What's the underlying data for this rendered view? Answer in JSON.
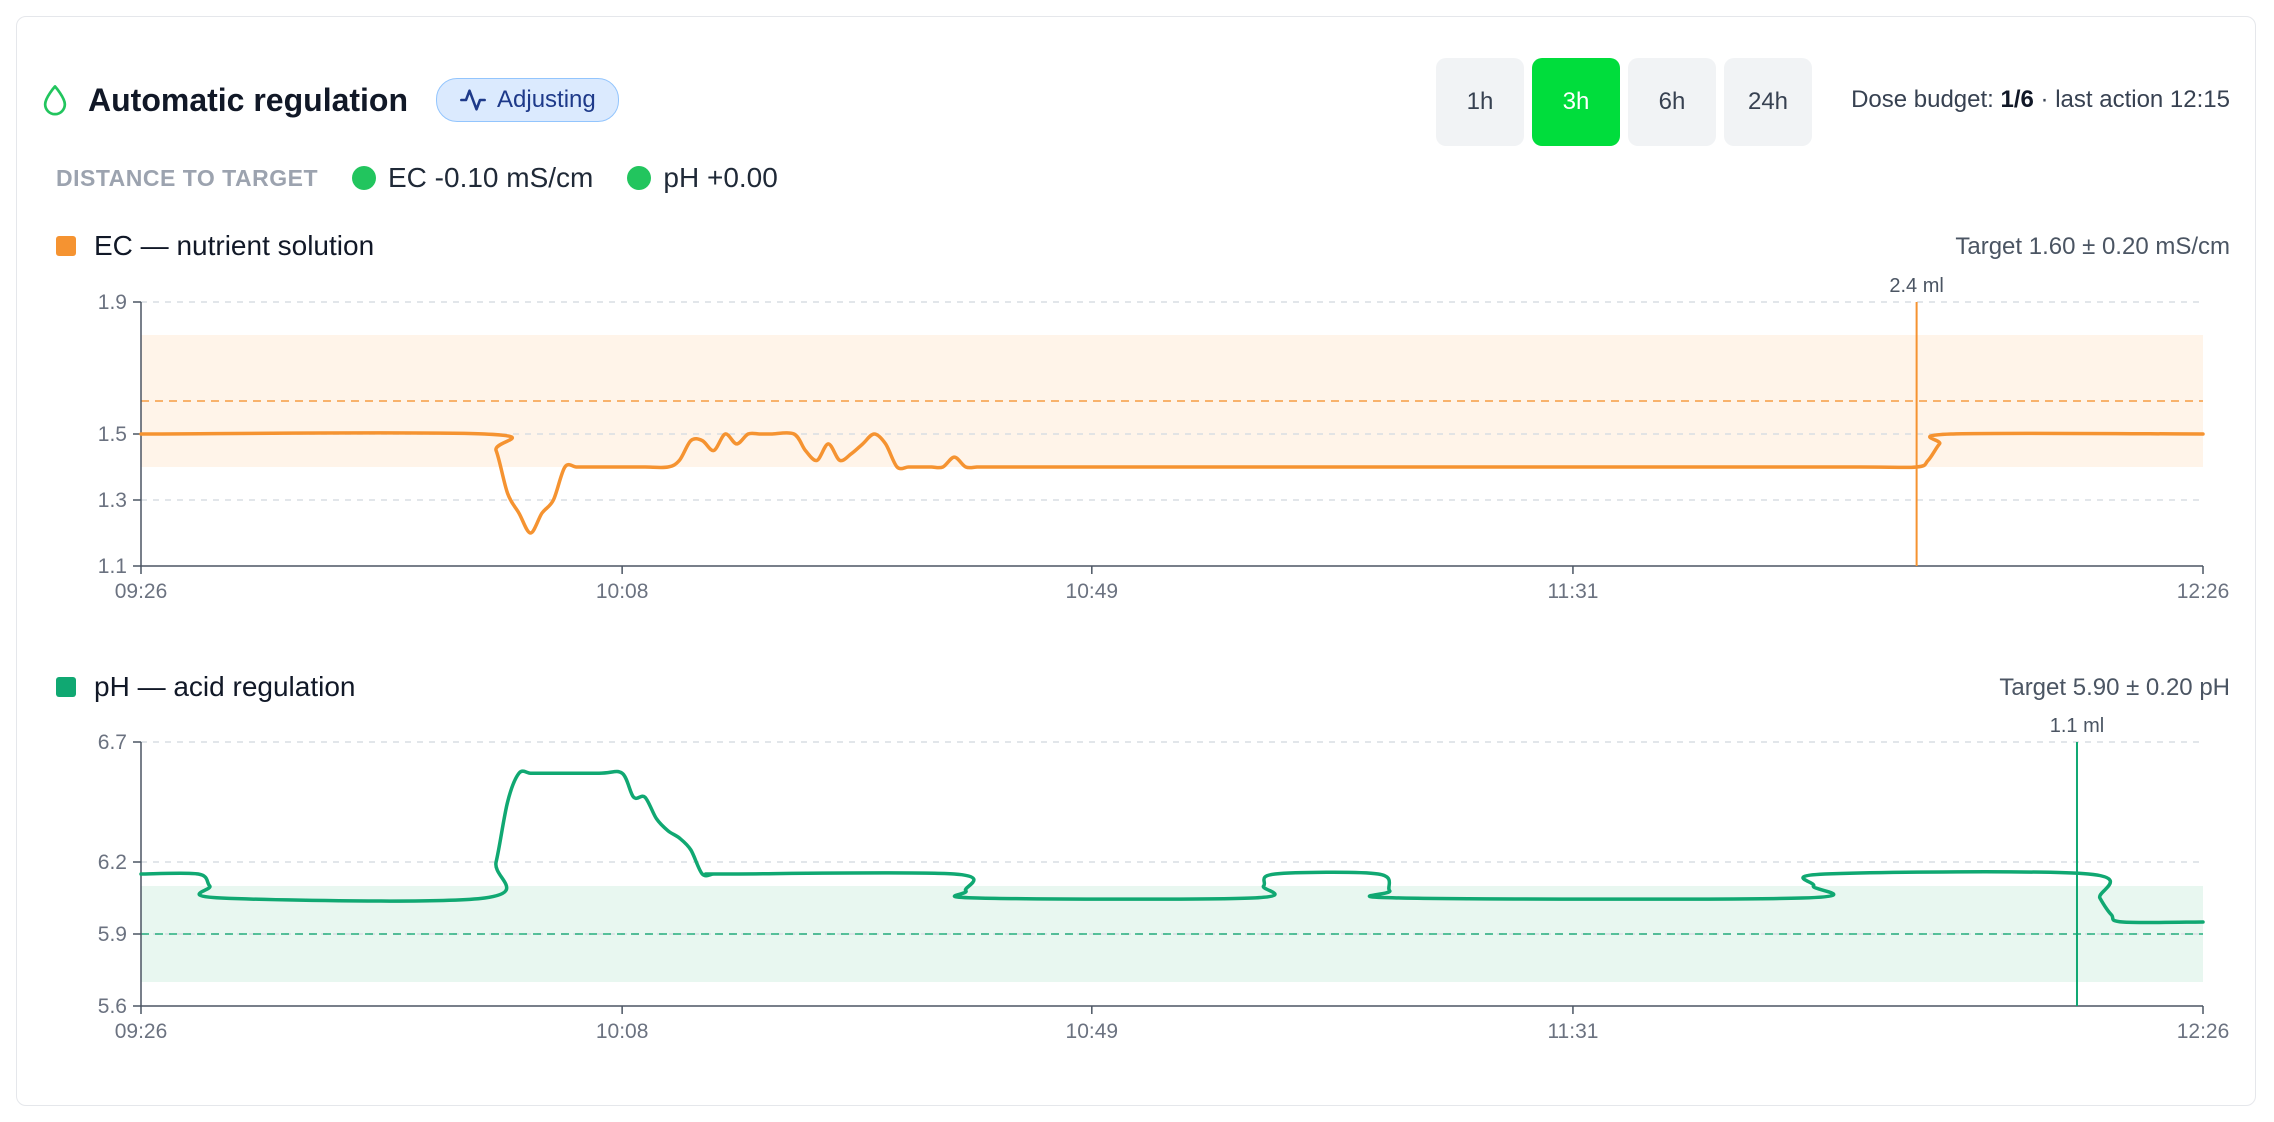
{
  "header": {
    "title": "Automatic regulation",
    "status_badge": "Adjusting",
    "ranges": [
      "1h",
      "3h",
      "6h",
      "24h"
    ],
    "active_range": "3h",
    "dose_budget_label": "Dose budget: ",
    "dose_budget_value": "1/6",
    "last_action": " · last action 12:15"
  },
  "distance": {
    "label": "DISTANCE TO TARGET",
    "ec": "EC -0.10 mS/cm",
    "ph": "pH +0.00"
  },
  "colors": {
    "ec": "#f59331",
    "ph": "#10a872",
    "ec_band": "#fff4e9",
    "ph_band": "#e8f7f0",
    "accent": "#00dd3c",
    "ok": "#22c55e"
  },
  "chart_data": [
    {
      "type": "line",
      "title": "EC — nutrient solution",
      "target_label": "Target 1.60 ± 0.20 mS/cm",
      "target": 1.6,
      "tolerance": 0.2,
      "ylim": [
        1.1,
        1.9
      ],
      "yticks": [
        "1.1",
        "1.3",
        "1.5",
        "1.9"
      ],
      "ytick_values": [
        1.1,
        1.3,
        1.5,
        1.9
      ],
      "xticks": [
        "09:26",
        "10:08",
        "10:49",
        "11:31",
        "12:26"
      ],
      "xtick_values": [
        0,
        42,
        83,
        125,
        180
      ],
      "dose_marker": {
        "x": 155,
        "label": "2.4 ml"
      },
      "series": [
        {
          "x": [
            0,
            30,
            31,
            32,
            33,
            34,
            35,
            36,
            37,
            38,
            39,
            40,
            41,
            42,
            44,
            46,
            47,
            48,
            49,
            50,
            51,
            52,
            53,
            54,
            55,
            57,
            58,
            59,
            60,
            61,
            62,
            63,
            64,
            65,
            66,
            67,
            68,
            69,
            70,
            71,
            72,
            73,
            74,
            75,
            100,
            130,
            150,
            155,
            156,
            157,
            158,
            180
          ],
          "values": [
            1.5,
            1.5,
            1.45,
            1.32,
            1.26,
            1.2,
            1.26,
            1.3,
            1.4,
            1.4,
            1.4,
            1.4,
            1.4,
            1.4,
            1.4,
            1.4,
            1.42,
            1.48,
            1.48,
            1.45,
            1.5,
            1.47,
            1.5,
            1.5,
            1.5,
            1.5,
            1.45,
            1.42,
            1.47,
            1.42,
            1.44,
            1.47,
            1.5,
            1.47,
            1.4,
            1.4,
            1.4,
            1.4,
            1.4,
            1.43,
            1.4,
            1.4,
            1.4,
            1.4,
            1.4,
            1.4,
            1.4,
            1.4,
            1.42,
            1.47,
            1.5,
            1.5
          ]
        }
      ]
    },
    {
      "type": "line",
      "title": "pH — acid regulation",
      "target_label": "Target 5.90 ± 0.20 pH",
      "target": 5.9,
      "tolerance": 0.2,
      "ylim": [
        5.6,
        6.7
      ],
      "yticks": [
        "5.6",
        "5.9",
        "6.2",
        "6.7"
      ],
      "ytick_values": [
        5.6,
        5.9,
        6.2,
        6.7
      ],
      "xticks": [
        "09:26",
        "10:08",
        "10:49",
        "11:31",
        "12:26"
      ],
      "xtick_values": [
        0,
        42,
        83,
        125,
        180
      ],
      "dose_marker": {
        "x": 169,
        "label": "1.1 ml"
      },
      "series": [
        {
          "x": [
            0,
            5,
            6,
            7,
            30,
            31,
            32,
            33,
            34,
            35,
            40,
            42,
            43,
            44,
            45,
            46,
            47,
            48,
            49,
            50,
            51,
            71,
            72,
            73,
            97,
            98,
            99,
            108,
            109,
            110,
            145,
            146,
            147,
            170,
            171,
            172,
            173,
            180
          ],
          "values": [
            6.15,
            6.15,
            6.1,
            6.05,
            6.05,
            6.2,
            6.45,
            6.57,
            6.57,
            6.57,
            6.57,
            6.57,
            6.47,
            6.47,
            6.38,
            6.33,
            6.3,
            6.25,
            6.15,
            6.15,
            6.15,
            6.15,
            6.08,
            6.05,
            6.05,
            6.1,
            6.15,
            6.15,
            6.08,
            6.05,
            6.05,
            6.1,
            6.15,
            6.15,
            6.05,
            5.98,
            5.95,
            5.95
          ]
        }
      ]
    }
  ]
}
